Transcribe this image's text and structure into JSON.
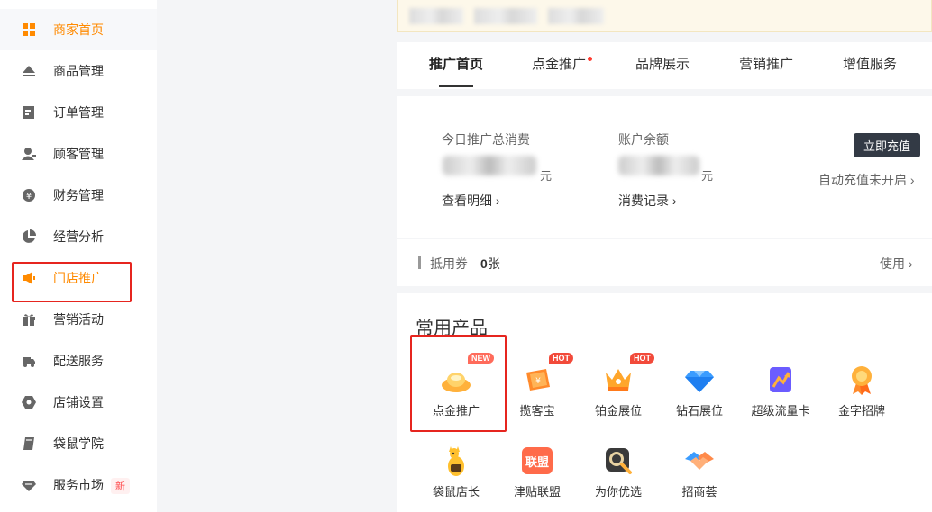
{
  "sidebar": {
    "items": [
      {
        "label": "商家首页",
        "icon": "grid-icon"
      },
      {
        "label": "商品管理",
        "icon": "eject-icon"
      },
      {
        "label": "订单管理",
        "icon": "order-icon"
      },
      {
        "label": "顾客管理",
        "icon": "user-icon"
      },
      {
        "label": "财务管理",
        "icon": "yen-icon"
      },
      {
        "label": "经营分析",
        "icon": "pie-chart-icon"
      },
      {
        "label": "门店推广",
        "icon": "megaphone-icon"
      },
      {
        "label": "营销活动",
        "icon": "gift-icon"
      },
      {
        "label": "配送服务",
        "icon": "delivery-truck-icon"
      },
      {
        "label": "店铺设置",
        "icon": "hexagon-settings-icon"
      },
      {
        "label": "袋鼠学院",
        "icon": "book-icon"
      },
      {
        "label": "服务市场",
        "icon": "diamond-icon",
        "badge": "新"
      }
    ],
    "accent": "#ff8a00"
  },
  "tabs": [
    {
      "label": "推广首页"
    },
    {
      "label": "点金推广"
    },
    {
      "label": "品牌展示"
    },
    {
      "label": "营销推广"
    },
    {
      "label": "增值服务"
    }
  ],
  "account": {
    "spend_label": "今日推广总消费",
    "spend_unit": "元",
    "detail_link": "查看明细 ›",
    "balance_label": "账户余额",
    "balance_unit": "元",
    "records_link": "消费记录 ›",
    "recharge_button": "立即充值",
    "auto_recharge": "自动充值未开启 ›"
  },
  "coupon": {
    "label": "抵用券",
    "count": "0",
    "count_unit": "张",
    "use_link": "使用 ›"
  },
  "products": {
    "title": "常用产品",
    "items": [
      {
        "name": "点金推广",
        "icon": "gold-ingot-icon",
        "tag": "NEW"
      },
      {
        "name": "揽客宝",
        "icon": "ticket-icon",
        "tag": "HOT"
      },
      {
        "name": "铂金展位",
        "icon": "crown-icon",
        "tag": "HOT"
      },
      {
        "name": "钻石展位",
        "icon": "diamond-gem-icon"
      },
      {
        "name": "超级流量卡",
        "icon": "traffic-card-icon"
      },
      {
        "name": "金字招牌",
        "icon": "medal-icon"
      },
      {
        "name": "袋鼠店长",
        "icon": "kangaroo-icon"
      },
      {
        "name": "津贴联盟",
        "icon": "alliance-icon",
        "icon_text": "联盟"
      },
      {
        "name": "为你优选",
        "icon": "magnifier-icon"
      },
      {
        "name": "招商荟",
        "icon": "handshake-icon"
      }
    ]
  }
}
